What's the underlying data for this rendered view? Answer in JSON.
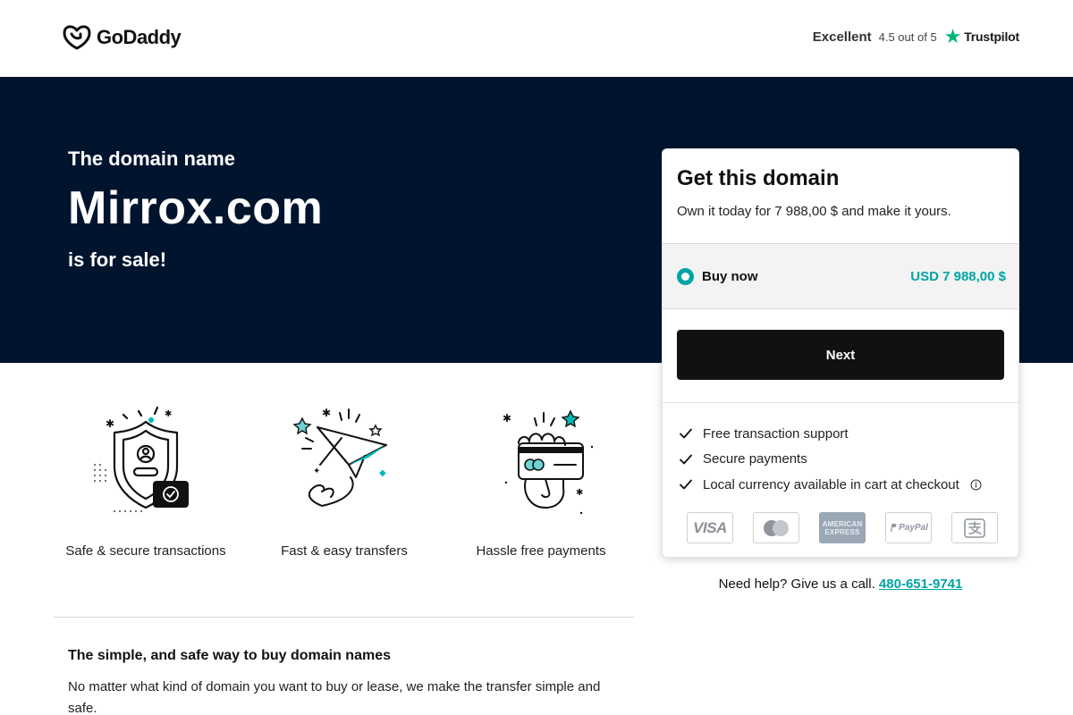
{
  "header": {
    "logo_text": "GoDaddy",
    "rating_label": "Excellent",
    "rating_score": "4.5 out of 5",
    "trustpilot_text": "Trustpilot"
  },
  "hero": {
    "pre": "The domain name",
    "domain": "Mirrox.com",
    "post": "is for sale!"
  },
  "features": [
    {
      "label": "Safe & secure transactions",
      "icon": "shield-icon"
    },
    {
      "label": "Fast & easy transfers",
      "icon": "paper-plane-icon"
    },
    {
      "label": "Hassle free payments",
      "icon": "card-payment-icon"
    }
  ],
  "about": {
    "title": "The simple, and safe way to buy domain names",
    "body": "No matter what kind of domain you want to buy or lease, we make the transfer simple and safe."
  },
  "card": {
    "title": "Get this domain",
    "subtitle": "Own it today for 7 988,00 $ and make it yours.",
    "option_label": "Buy now",
    "option_price": "USD 7 988,00 $",
    "next_label": "Next",
    "benefits": [
      "Free transaction support",
      "Secure payments",
      "Local currency available in cart at checkout"
    ],
    "payment_methods": {
      "visa": "VISA",
      "mastercard": "mastercard-icon",
      "amex_top": "AMERICAN",
      "amex_bottom": "EXPRESS",
      "paypal": "PayPal",
      "alipay": "alipay-icon"
    }
  },
  "help": {
    "text": "Need help? Give us a call.",
    "phone": "480-651-9741"
  },
  "colors": {
    "hero_bg": "#00142e",
    "accent": "#00a4a6",
    "button_bg": "#111111",
    "trustpilot": "#00b67a"
  }
}
